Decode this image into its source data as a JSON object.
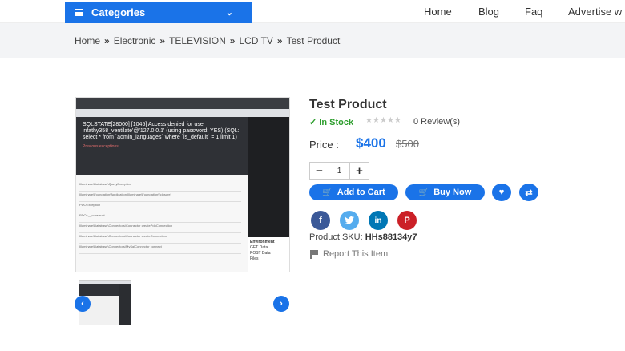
{
  "nav": {
    "categories_label": "Categories",
    "menu": [
      "Home",
      "Blog",
      "Faq",
      "Advertise w"
    ]
  },
  "breadcrumb": [
    "Home",
    "Electronic",
    "TELEVISION",
    "LCD TV",
    "Test Product"
  ],
  "product": {
    "title": "Test Product",
    "stock": "In Stock",
    "rating": 0,
    "max_rating": 5,
    "reviews": "0 Review(s)",
    "price_label": "Price :",
    "price": "$400",
    "old_price": "$500",
    "quantity": "1",
    "add_to_cart": "Add to Cart",
    "buy_now": "Buy Now",
    "sku_label": "Product SKU:",
    "sku": "HHs88134y7",
    "report": "Report This Item"
  },
  "image_text": {
    "error_lines": "SQLSTATE[28000] [1045] Access denied for user 'nfathy358_ventilate'@'127.0.0.1' (using password: YES) (SQL: select * from `admin_languages` where `is_default` = 1 limit 1)",
    "prev_exception": "Previous exceptions",
    "rows": [
      "Illuminate\\Database\\QueryException",
      "Illuminate\\Foundation\\Application Illuminate\\Foundation\\{closure}",
      "PDOException",
      "PDO::__construct",
      "Illuminate\\Database\\Connectors\\Connector createPdoConnection",
      "Illuminate\\Database\\Connectors\\Connector createConnection",
      "Illuminate\\Database\\Connectors\\MySqlConnector connect"
    ],
    "panel_title": "Environment",
    "panel_rows": [
      "GET Data",
      "POST Data",
      "Files"
    ]
  },
  "colors": {
    "accent": "#1a73e8",
    "in_stock": "#2e9e2e",
    "facebook": "#3b5998",
    "twitter": "#55acee",
    "linkedin": "#0077b5",
    "pinterest": "#cb2027"
  }
}
